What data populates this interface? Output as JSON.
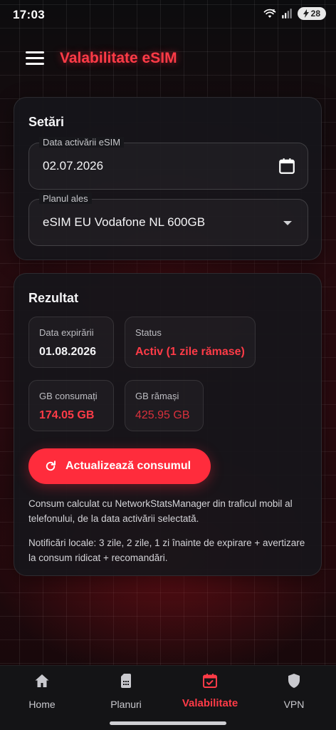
{
  "status_bar": {
    "time": "17:03",
    "battery": "28"
  },
  "app_bar": {
    "title": "Valabilitate eSIM"
  },
  "settings": {
    "title": "Setări",
    "activation_date": {
      "label": "Data activării eSIM",
      "value": "02.07.2026"
    },
    "plan": {
      "label": "Planul ales",
      "value": "eSIM EU Vodafone NL 600GB"
    }
  },
  "result": {
    "title": "Rezultat",
    "expiry": {
      "label": "Data expirării",
      "value": "01.08.2026"
    },
    "status": {
      "label": "Status",
      "value": "Activ (1 zile rămase)"
    },
    "used": {
      "label": "GB consumați",
      "value": "174.05 GB"
    },
    "remaining": {
      "label": "GB rămași",
      "value": "425.95 GB"
    },
    "update_button": "Actualizează consumul",
    "note1": "Consum calculat cu NetworkStatsManager din traficul mobil al telefonului, de la data activării selectată.",
    "note2": "Notificări locale: 3 zile, 2 zile, 1 zi înainte de expirare + avertizare la consum ridicat + recomandări."
  },
  "nav": [
    {
      "label": "Home",
      "icon": "home-icon"
    },
    {
      "label": "Planuri",
      "icon": "sim-card-icon"
    },
    {
      "label": "Valabilitate",
      "icon": "calendar-check-icon",
      "active": true
    },
    {
      "label": "VPN",
      "icon": "shield-icon"
    }
  ],
  "colors": {
    "accent": "#ff2c3c",
    "accent_text": "#ff3b47",
    "background": "#120a0c",
    "card": "#16161a"
  }
}
